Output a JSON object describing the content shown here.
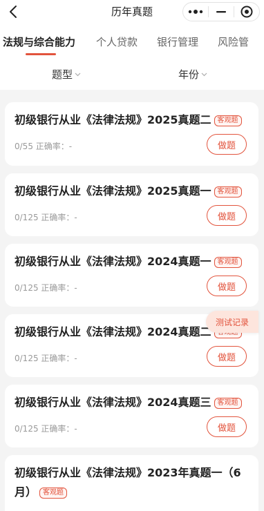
{
  "header": {
    "title": "历年真题"
  },
  "tabs": [
    {
      "label": "法规与综合能力"
    },
    {
      "label": "个人贷款"
    },
    {
      "label": "银行管理"
    },
    {
      "label": "风险管"
    }
  ],
  "filters": {
    "type_label": "题型",
    "year_label": "年份"
  },
  "cards": [
    {
      "title": "初级银行从业《法律法规》2025真题二",
      "badge": "客观题",
      "progress": "0/55 正确率：-",
      "button": "做题"
    },
    {
      "title": "初级银行从业《法律法规》2025真题一",
      "badge": "客观题",
      "progress": "0/125 正确率：-",
      "button": "做题"
    },
    {
      "title": "初级银行从业《法律法规》2024真题一",
      "badge": "客观题",
      "progress": "0/125 正确率：-",
      "button": "做题"
    },
    {
      "title": "初级银行从业《法律法规》2024真题二",
      "badge": "客观题",
      "progress": "0/125 正确率：-",
      "button": "做题"
    },
    {
      "title": "初级银行从业《法律法规》2024真题三",
      "badge": "客观题",
      "progress": "0/125 正确率：-",
      "button": "做题"
    },
    {
      "title": "初级银行从业《法律法规》2023年真题一（6月）",
      "badge": "客观题",
      "progress": "",
      "button": ""
    }
  ],
  "floating": {
    "record_label": "测试记录"
  },
  "colors": {
    "accent": "#e2533c",
    "background": "#f4f4f4"
  }
}
